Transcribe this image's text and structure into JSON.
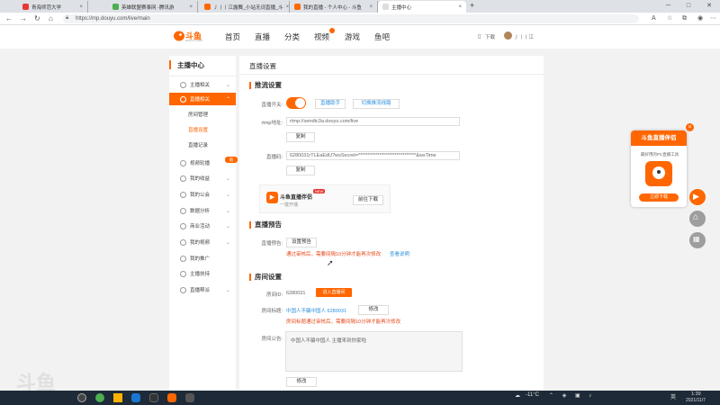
{
  "browser": {
    "tabs": [
      {
        "title": "青海师范大学",
        "active": false
      },
      {
        "title": "英雄联盟赛事网 -腾讯游",
        "active": false
      },
      {
        "title": "丿丨丨江露舞_小站无词直播_斗",
        "active": false
      },
      {
        "title": "我的直播 - 个人中心 - 斗鱼",
        "active": false
      },
      {
        "title": "主播中心",
        "active": true
      }
    ],
    "new_tab": "+",
    "url": "https://mp.douyu.com/live/main"
  },
  "site": {
    "logo_text": "斗鱼",
    "logo_sub": "DOUYU.COM",
    "nav": [
      "首页",
      "直播",
      "分类",
      "视频",
      "游戏",
      "鱼吧"
    ],
    "download": "下载",
    "username": "丿丨丨江"
  },
  "sidebar": {
    "title": "主播中心",
    "items": [
      {
        "label": "主播相关",
        "chev": "⌄"
      },
      {
        "label": "直播相关",
        "chev": "⌃"
      },
      {
        "label": "视频轮播",
        "chev": "",
        "badge": "新"
      },
      {
        "label": "我的收益",
        "chev": "⌄"
      },
      {
        "label": "我的公会",
        "chev": "⌄"
      },
      {
        "label": "数据分析",
        "chev": "⌄"
      },
      {
        "label": "商业活动",
        "chev": "⌄"
      },
      {
        "label": "我的视频",
        "chev": "⌄"
      },
      {
        "label": "我的推广",
        "chev": ""
      },
      {
        "label": "主播扶持",
        "chev": ""
      },
      {
        "label": "直播帮派",
        "chev": "⌄"
      }
    ],
    "subitems": [
      "房间管理",
      "直播设置",
      "直播记录"
    ]
  },
  "main": {
    "title": "直播设置",
    "push": {
      "section": "推流设置",
      "switch_label": "直播开关:",
      "btn_live_tool": "直播助手",
      "btn_switch_source": "切换推流线路",
      "rtmp_label": "rtmp地址:",
      "rtmp_value": "rtmp://sendtc3a.douyu.com/live",
      "copy": "复制",
      "code_label": "直播码:",
      "code_value": "6280031rTLEaEdU?wsSecret=******************************&wsTime",
      "copy2": "复制",
      "helper_name": "斗鱼直播伴侣",
      "helper_new": "NEW",
      "helper_desc": "一键开播",
      "helper_download": "前往下载"
    },
    "notice": {
      "section": "直播预告",
      "label": "直播预告:",
      "btn": "设置预告",
      "warning": "通过审核后，需要间隔10分钟才能再次修改",
      "link": "查看说明"
    },
    "room": {
      "section": "房间设置",
      "id_label": "房间ID:",
      "id_value": "6280031",
      "id_btn": "进入直播间",
      "title_label": "房间标题:",
      "title_value": "中国人不骗中国人 6280031",
      "title_btn": "修改",
      "title_warning": "房间标题通过审核后，需要间隔10分钟才能再次修改",
      "announce_label": "房间公告:",
      "announce_value": "中国人不骗中国人 主播来到你家啦",
      "announce_btn": "修改"
    }
  },
  "promo": {
    "title": "斗鱼直播伴侣",
    "desc": "最好用的PC直播工具",
    "btn": "立即下载",
    "close": "×"
  },
  "watermark": "斗鱼",
  "taskbar": {
    "temp": "-11°C",
    "lang": "英",
    "time": "1:39",
    "date": "2021/11/7"
  },
  "colors": {
    "accent": "#ff6600",
    "link": "#2b8fde",
    "warn": "#e64a19"
  }
}
